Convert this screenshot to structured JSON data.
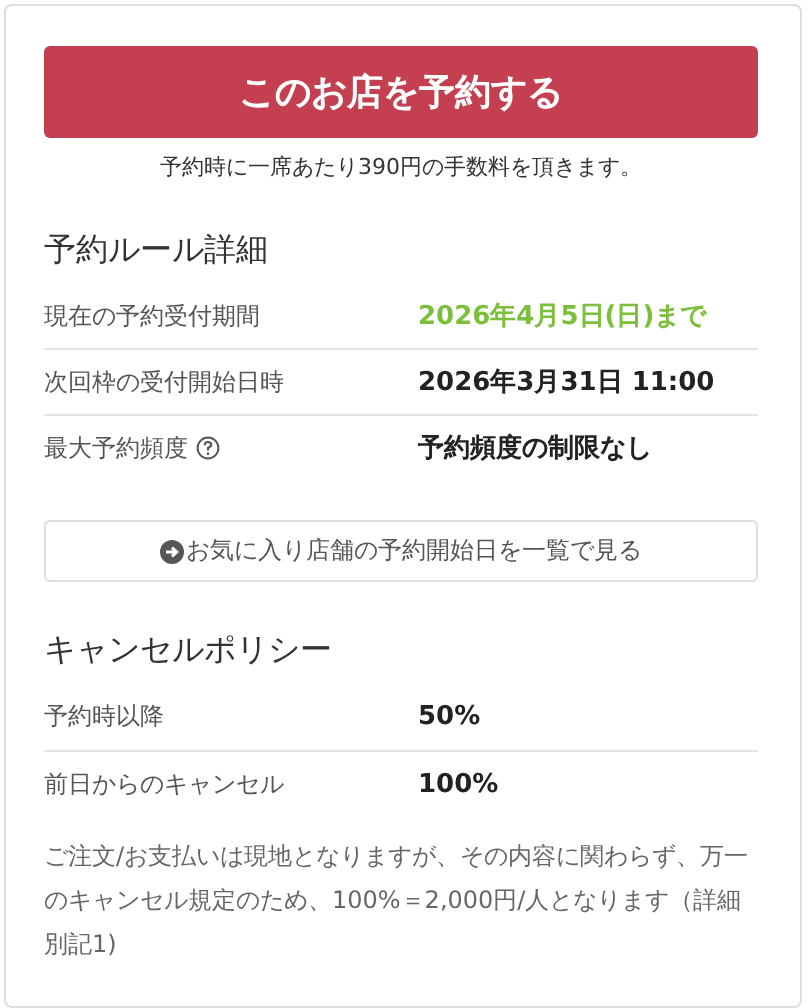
{
  "reserve_button": {
    "label": "このお店を予約する"
  },
  "fee_note": "予約時に一席あたり390円の手数料を頂きます。",
  "rules": {
    "title": "予約ルール詳細",
    "rows": [
      {
        "label": "現在の予約受付期間",
        "value": "2026年4月5日(日)まで",
        "kind": "accent",
        "help": false
      },
      {
        "label": "次回枠の受付開始日時",
        "value": "2026年3月31日 11:00",
        "kind": "plain",
        "help": false
      },
      {
        "label": "最大予約頻度",
        "value": "予約頻度の制限なし",
        "kind": "plain",
        "help": true
      }
    ]
  },
  "favorites_button": {
    "label": "お気に入り店舗の予約開始日を一覧で見る"
  },
  "cancel_policy": {
    "title": "キャンセルポリシー",
    "rows": [
      {
        "label": "予約時以降",
        "value": "50%"
      },
      {
        "label": "前日からのキャンセル",
        "value": "100%"
      }
    ],
    "note": "ご注文/お支払いは現地となりますが、その内容に関わらず、万一のキャンセル規定のため、100%＝2,000円/人となります（詳細別記1)"
  }
}
